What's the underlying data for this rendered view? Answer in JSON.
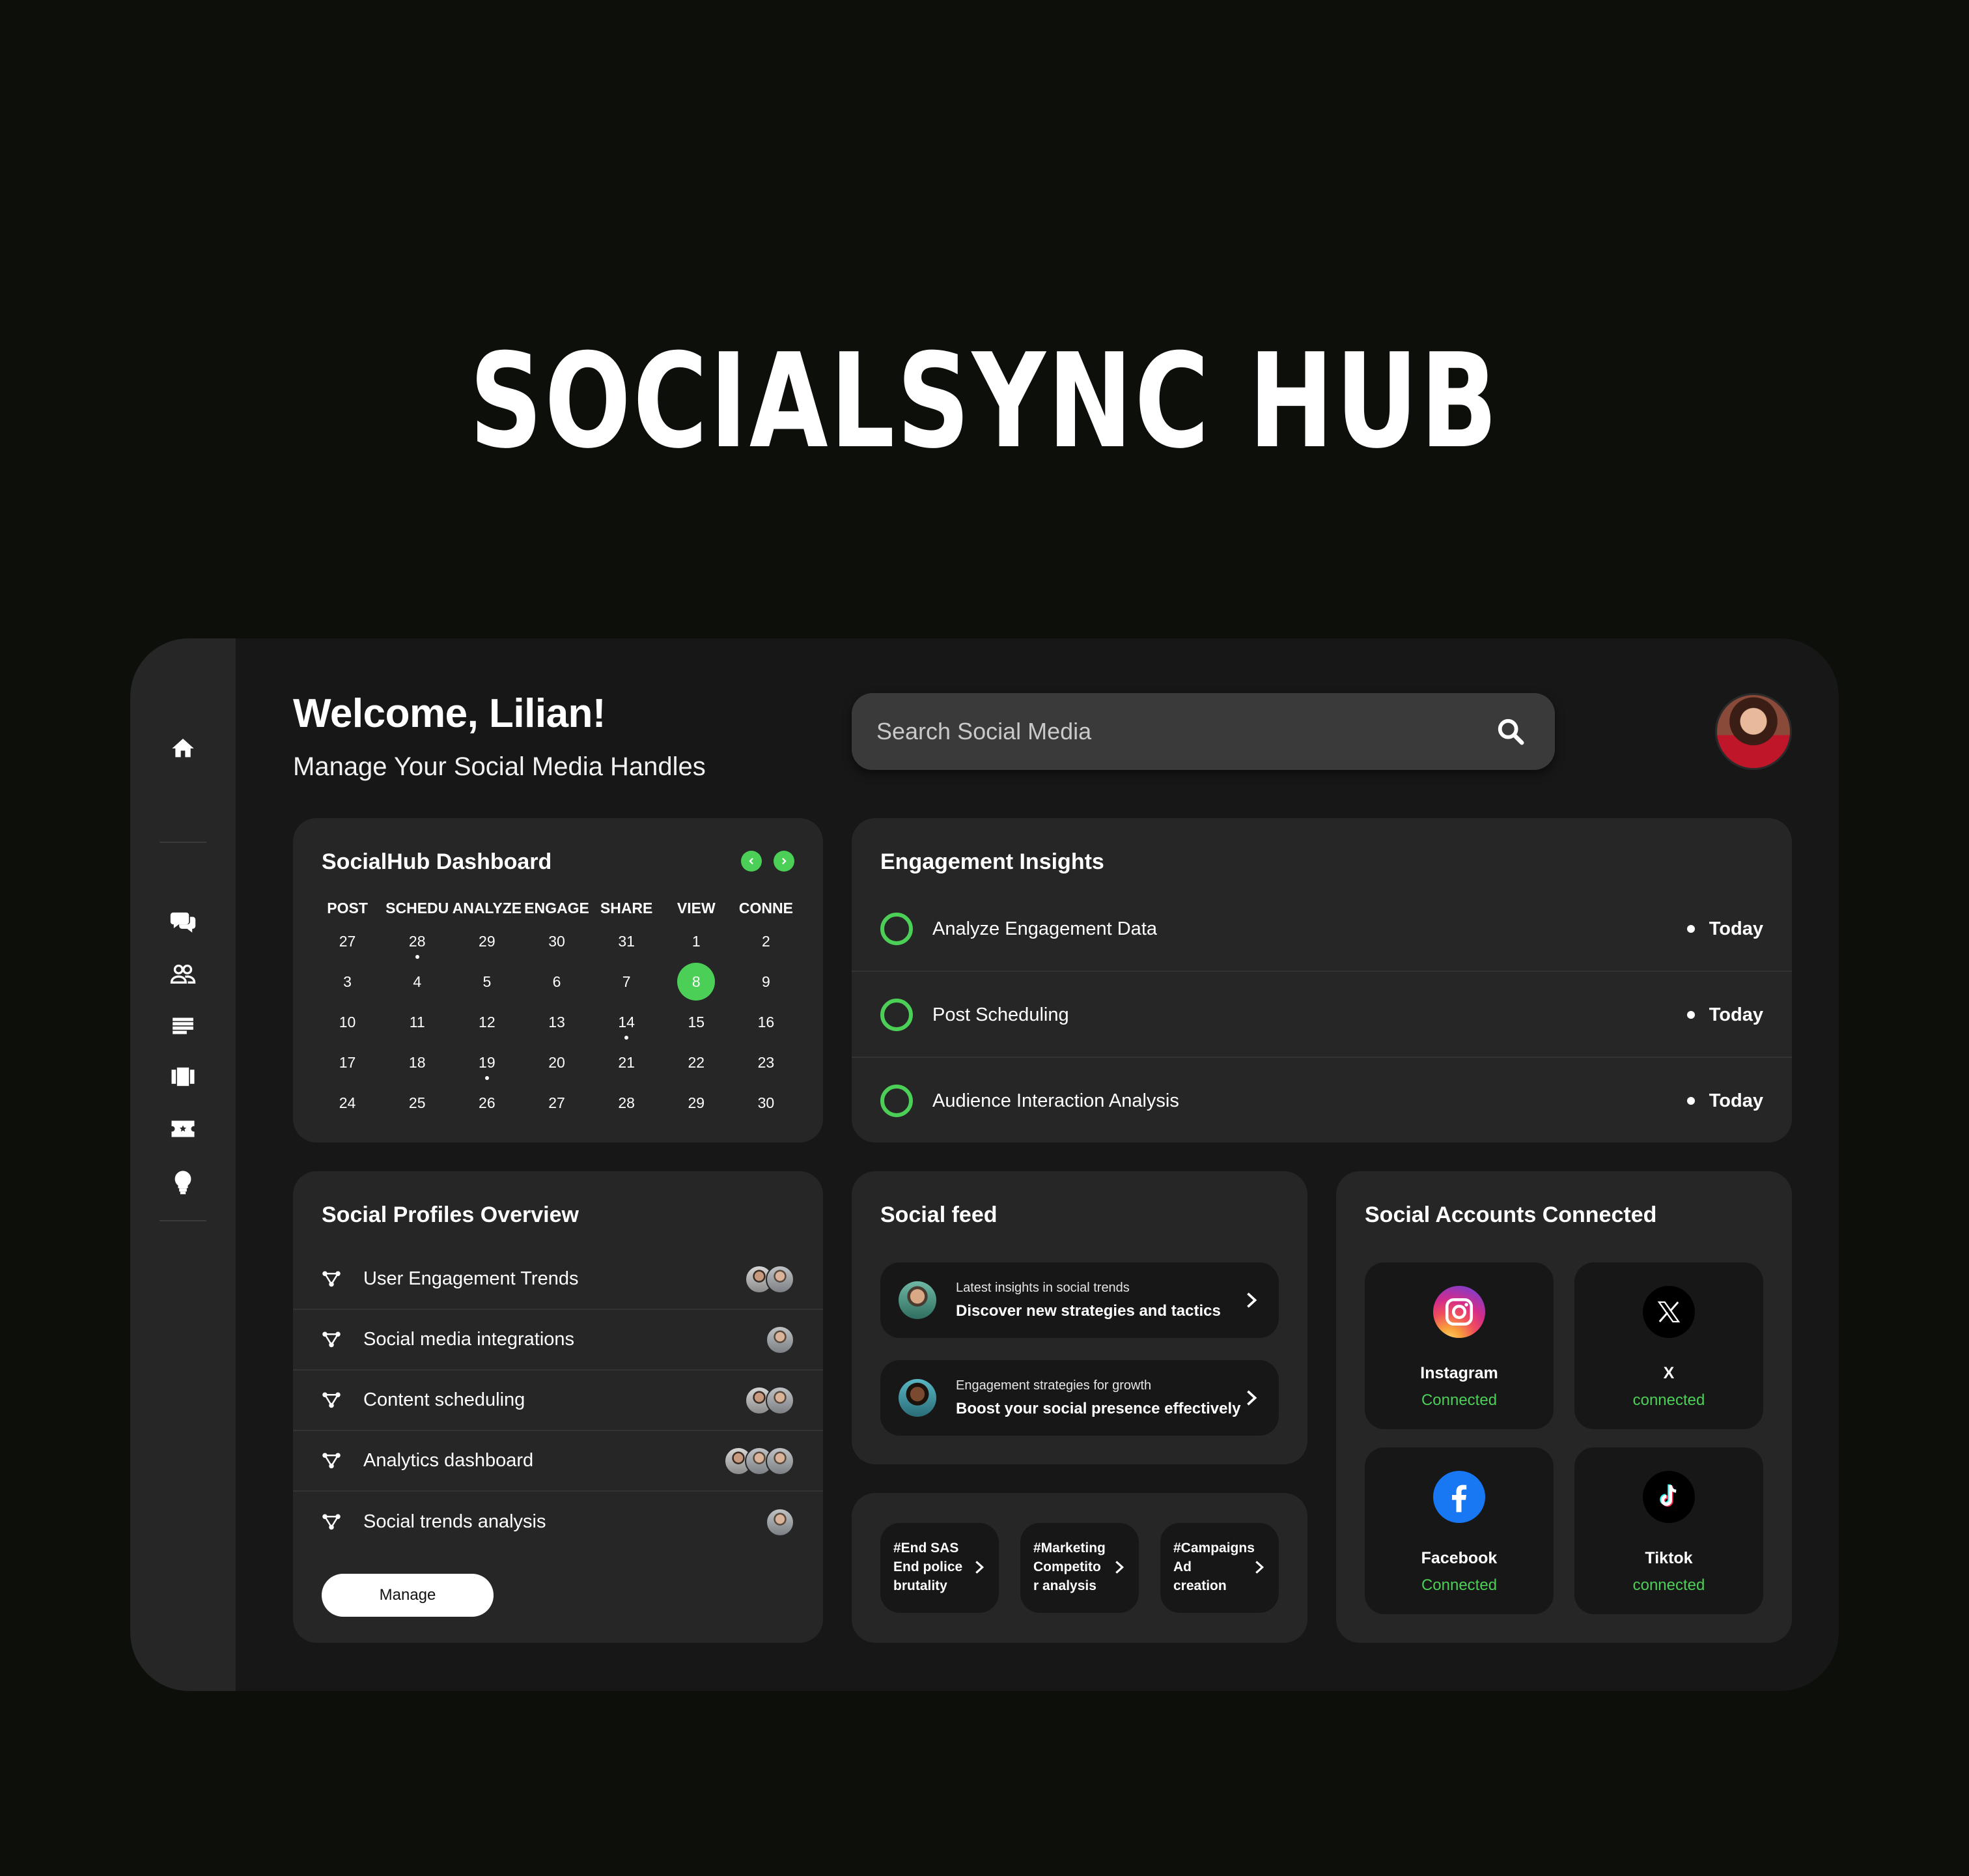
{
  "hero": {
    "title": "SOCIALSYNC HUB"
  },
  "header": {
    "welcome": "Welcome, Lilian!",
    "subtitle": "Manage Your Social Media Handles",
    "search_placeholder": "Search Social Media"
  },
  "calendar": {
    "title": "SocialHub Dashboard",
    "headers": [
      "POST",
      "SCHEDU",
      "ANALYZE",
      "ENGAGE",
      "SHARE",
      "VIEW",
      "CONNE"
    ],
    "rows": [
      [
        "27",
        "28",
        "29",
        "30",
        "31",
        "1",
        "2"
      ],
      [
        "3",
        "4",
        "5",
        "6",
        "7",
        "8",
        "9"
      ],
      [
        "10",
        "11",
        "12",
        "13",
        "14",
        "15",
        "16"
      ],
      [
        "17",
        "18",
        "19",
        "20",
        "21",
        "22",
        "23"
      ],
      [
        "24",
        "25",
        "26",
        "27",
        "28",
        "29",
        "30"
      ]
    ],
    "selected": "8",
    "accent": "#4ccf57"
  },
  "engagement": {
    "title": "Engagement Insights",
    "items": [
      {
        "label": "Analyze Engagement Data",
        "when": "Today"
      },
      {
        "label": "Post Scheduling",
        "when": "Today"
      },
      {
        "label": "Audience Interaction Analysis",
        "when": "Today"
      }
    ]
  },
  "profiles": {
    "title": "Social Profiles Overview",
    "items": [
      {
        "label": "User Engagement Trends"
      },
      {
        "label": "Social media integrations"
      },
      {
        "label": "Content scheduling"
      },
      {
        "label": "Analytics dashboard"
      },
      {
        "label": "Social trends analysis"
      }
    ],
    "manage_label": "Manage"
  },
  "feed": {
    "title": "Social feed",
    "items": [
      {
        "sub": "Latest insights in social trends",
        "main": "Discover new strategies and tactics"
      },
      {
        "sub": "Engagement strategies for growth",
        "main": "Boost your social presence effectively"
      }
    ]
  },
  "tags": [
    {
      "line1": "#End SAS",
      "line2": "End police",
      "line3": "brutality"
    },
    {
      "line1": "#Marketing",
      "line2": "Competito",
      "line3": "r analysis"
    },
    {
      "line1": "#Campaigns",
      "line2": "Ad creation",
      "line3": ""
    }
  ],
  "accounts": {
    "title": "Social Accounts Connected",
    "items": [
      {
        "name": "Instagram",
        "status": "Connected",
        "icon": "instagram-icon"
      },
      {
        "name": "X",
        "status": "connected",
        "icon": "x-icon"
      },
      {
        "name": "Facebook",
        "status": "Connected",
        "icon": "facebook-icon"
      },
      {
        "name": "Tiktok",
        "status": "connected",
        "icon": "tiktok-icon"
      }
    ]
  }
}
